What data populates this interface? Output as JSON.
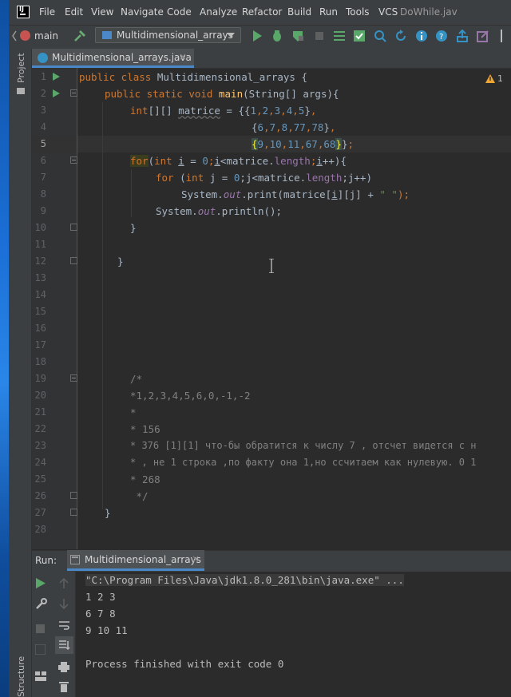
{
  "app": {
    "menu": [
      "File",
      "Edit",
      "View",
      "Navigate",
      "Code",
      "Analyze",
      "Refactor",
      "Build",
      "Run",
      "Tools",
      "VCS"
    ],
    "window_title": "DoWhile.jav"
  },
  "toolbar": {
    "branch": "main",
    "run_config": "Multidimensional_arrays"
  },
  "side": {
    "project_label": "Project",
    "structure_label": "Structure"
  },
  "editor": {
    "tab": "Multidimensional_arrays.java",
    "warnings_count": "1",
    "line_numbers": [
      "1",
      "2",
      "3",
      "4",
      "5",
      "6",
      "7",
      "8",
      "9",
      "10",
      "11",
      "12",
      "13",
      "14",
      "15",
      "16",
      "17",
      "18",
      "19",
      "20",
      "21",
      "22",
      "23",
      "24",
      "25",
      "26",
      "27",
      "28"
    ],
    "code": {
      "l1_kw": "public class ",
      "l1_name": "Multidimensional_arrays {",
      "l2_kw": "public static void ",
      "l2_fn": "main",
      "l2_rest": "(String[] args){",
      "l3_kw": "int",
      "l3_a": "[][] ",
      "l3_var": "matrice",
      "l3_b": " = {{",
      "row1": [
        "1",
        "2",
        "3",
        "4",
        "5"
      ],
      "row2": [
        "6",
        "7",
        "8",
        "77",
        "78"
      ],
      "row3": [
        "9",
        "10",
        "11",
        "67",
        "68"
      ],
      "l6_for": "for",
      "l6_b": "(",
      "l6_kw": "int ",
      "l6_i": "i",
      "l6_c": " = ",
      "l6_zero": "0",
      "l6_d": ";",
      "l6_i2": "i",
      "l6_e": "<matrice.",
      "l6_len": "length",
      "l6_f": ";",
      "l6_i3": "i",
      "l6_g": "++){",
      "l7_for": "for ",
      "l7_b": "(",
      "l7_kw": "int ",
      "l7_c": "j = ",
      "l7_zero": "0",
      "l7_d": ";j<matrice.",
      "l7_len": "length",
      "l7_e": ";j++)",
      "l8_a": "System.",
      "l8_out": "out",
      "l8_b": ".print(matrice[",
      "l8_i": "i",
      "l8_c": "][j] + ",
      "l8_str": "\" \"",
      "l8_d": ");",
      "l9_a": "System.",
      "l9_out": "out",
      "l9_b": ".println();",
      "l10": "}",
      "l12": "}",
      "c19": "/*",
      "c20": "*1,2,3,4,5,6,0,-1,-2",
      "c21": "*",
      "c22": "* 156",
      "c23": "* 376 [1][1] что-бы обратится к числу 7 , отсчет видется с н",
      "c24": "* , не 1 строка ,по факту она 1,но ссчитаем как нулевую. 0 1",
      "c25": "* 268",
      "c26": " */",
      "l27": "}"
    }
  },
  "run": {
    "label": "Run:",
    "tab": "Multidimensional_arrays",
    "cmd": "\"C:\\Program Files\\Java\\jdk1.8.0_281\\bin\\java.exe\" ...",
    "output": [
      "1 2 3",
      "6 7 8",
      "9 10 11",
      "",
      "Process finished with exit code 0"
    ]
  }
}
